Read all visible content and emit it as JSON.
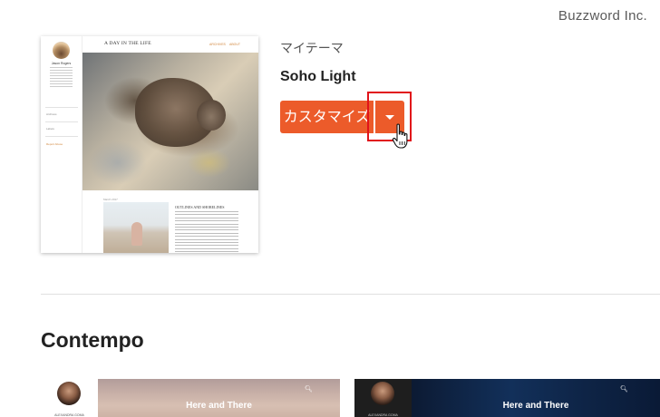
{
  "watermark": "Buzzword Inc.",
  "current_theme": {
    "section_label": "マイテーマ",
    "name": "Soho Light",
    "customize_label": "カスタマイズ",
    "preview": {
      "blog_title": "A DAY IN THE LIFE",
      "nav_items": [
        "ARCHIVES",
        "ABOUT"
      ],
      "author_name": "Jason Rogers",
      "sidebar_menus": [
        "Archives",
        "Labels",
        "Report Abuse"
      ],
      "post_meta": "March 2017",
      "post_title": "OUTLINES AND SHORELINES"
    }
  },
  "section_title": "Contempo",
  "cards": [
    {
      "author": "ALEXANDRA GOMA",
      "title": "Here and There",
      "search_icon": "search-icon"
    },
    {
      "author": "ALEXANDRA GOMA",
      "title": "Here and There",
      "search_icon": "search-icon"
    }
  ],
  "colors": {
    "accent": "#ec5b2a",
    "highlight": "#e1131a"
  }
}
